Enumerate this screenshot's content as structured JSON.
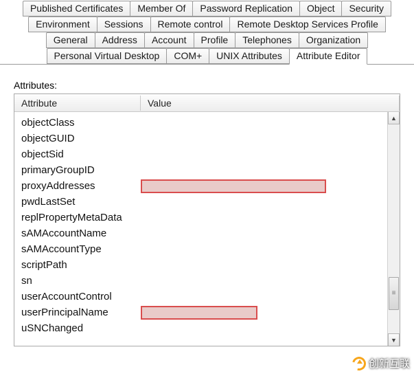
{
  "tabs": {
    "row0": [
      "Published Certificates",
      "Member Of",
      "Password Replication",
      "Object",
      "Security"
    ],
    "row1": [
      "Environment",
      "Sessions",
      "Remote control",
      "Remote Desktop Services Profile"
    ],
    "row2": [
      "General",
      "Address",
      "Account",
      "Profile",
      "Telephones",
      "Organization"
    ],
    "row3": [
      "Personal Virtual Desktop",
      "COM+",
      "UNIX Attributes",
      "Attribute Editor"
    ],
    "active": "Attribute Editor"
  },
  "section_label": "Attributes:",
  "columns": {
    "attr": "Attribute",
    "val": "Value"
  },
  "rows": [
    {
      "attr": "objectClass",
      "val": ""
    },
    {
      "attr": "objectGUID",
      "val": ""
    },
    {
      "attr": "objectSid",
      "val": ""
    },
    {
      "attr": "primaryGroupID",
      "val": ""
    },
    {
      "attr": "proxyAddresses",
      "val": "",
      "redacted": true
    },
    {
      "attr": "pwdLastSet",
      "val": ""
    },
    {
      "attr": "replPropertyMetaData",
      "val": ""
    },
    {
      "attr": "sAMAccountName",
      "val": ""
    },
    {
      "attr": "sAMAccountType",
      "val": ""
    },
    {
      "attr": "scriptPath",
      "val": ""
    },
    {
      "attr": "sn",
      "val": ""
    },
    {
      "attr": "userAccountControl",
      "val": ""
    },
    {
      "attr": "userPrincipalName",
      "val": "",
      "redacted": "small"
    },
    {
      "attr": "uSNChanged",
      "val": ""
    }
  ],
  "watermark_text": "创新互联"
}
